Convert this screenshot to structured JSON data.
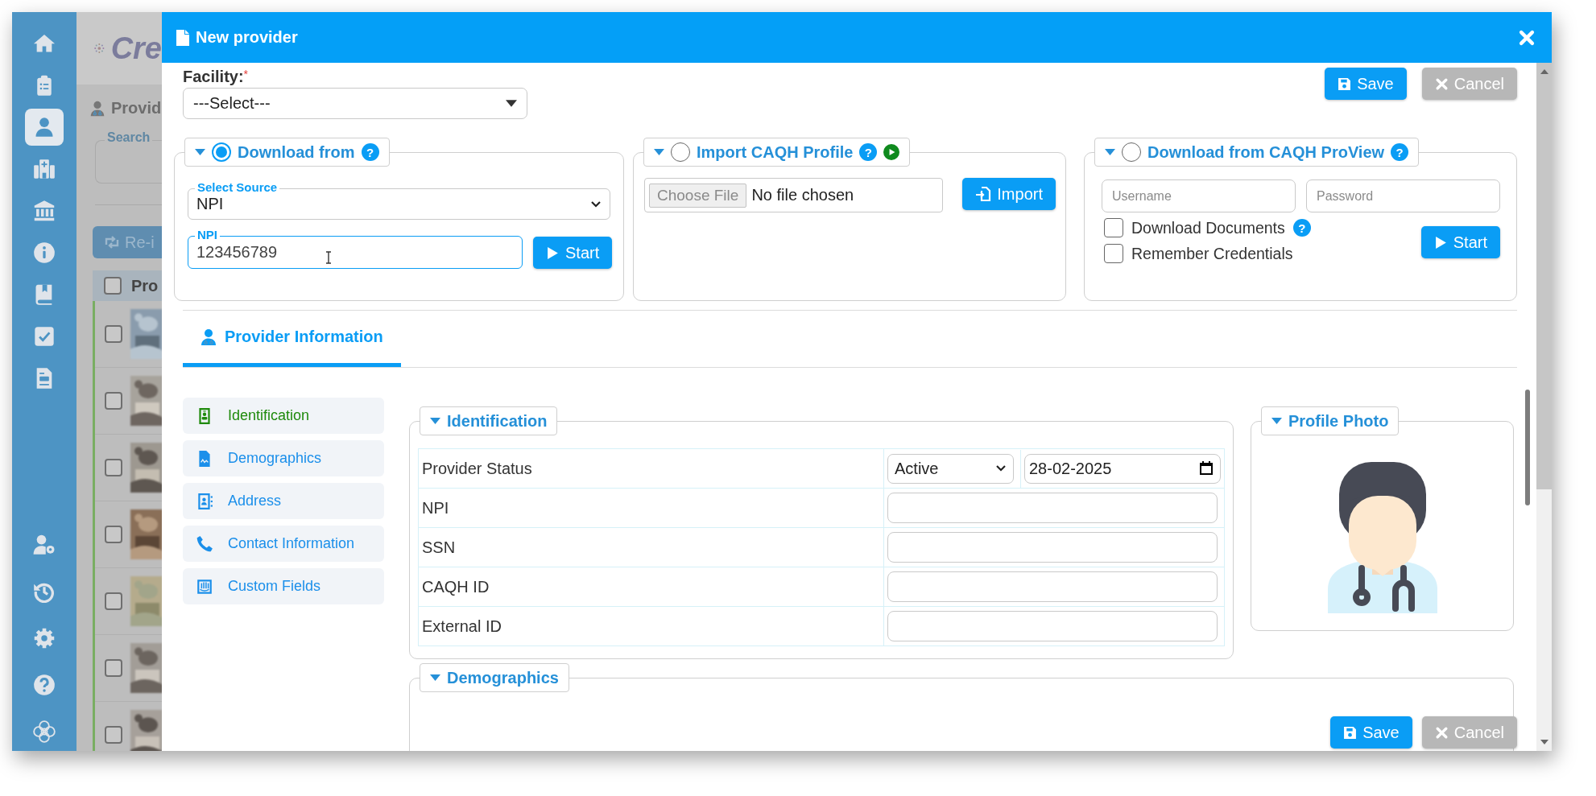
{
  "sidebar": {
    "top_items": [
      {
        "selected": false
      },
      {
        "selected": false
      },
      {
        "selected": true
      },
      {
        "selected": false
      },
      {
        "selected": false
      },
      {
        "selected": false
      },
      {
        "selected": false
      },
      {
        "selected": false
      },
      {
        "selected": false
      }
    ],
    "bottom_items": [
      {
        "selected": false
      },
      {
        "selected": false
      },
      {
        "selected": false
      },
      {
        "selected": false
      },
      {
        "selected": false
      }
    ]
  },
  "background_page": {
    "logo_text": "Cre",
    "title": "Provid",
    "search_label": "Search",
    "reindex_button": "Re-i",
    "column_header": "Pro",
    "header_checked": false,
    "rows": [
      {
        "checked": false
      },
      {
        "checked": false
      },
      {
        "checked": false
      },
      {
        "checked": false
      },
      {
        "checked": false
      },
      {
        "checked": false
      },
      {
        "checked": false
      }
    ]
  },
  "dialog": {
    "title": "New provider",
    "facility": {
      "label": "Facility:",
      "required_mark": "*",
      "value": "---Select---"
    },
    "top_actions": [
      {
        "label": "Save",
        "kind": "primary"
      },
      {
        "label": "Cancel",
        "kind": "secondary"
      }
    ],
    "download_from": {
      "title": "Download from",
      "selected": true,
      "help": "?",
      "source_label": "Select Source",
      "source_value": "NPI",
      "npi_label": "NPI",
      "npi_value": "123456789",
      "button": "Start"
    },
    "import_caqh": {
      "title": "Import CAQH Profile",
      "selected": false,
      "help": "?",
      "play": true,
      "file_button": "Choose File",
      "file_status": "No file chosen",
      "button": "Import"
    },
    "caqh_proview": {
      "title": "Download from CAQH ProView",
      "selected": false,
      "help": "?",
      "username_placeholder": "Username",
      "password_placeholder": "Password",
      "options": [
        {
          "label": "Download Documents",
          "checked": false,
          "help": "?"
        },
        {
          "label": "Remember Credentials",
          "checked": false
        }
      ],
      "button": "Start"
    },
    "tabs": [
      {
        "label": "Provider Information",
        "selected": true
      }
    ],
    "section_nav": [
      {
        "label": "Identification",
        "selected": true
      },
      {
        "label": "Demographics",
        "selected": false
      },
      {
        "label": "Address",
        "selected": false
      },
      {
        "label": "Contact Information",
        "selected": false
      },
      {
        "label": "Custom Fields",
        "selected": false
      }
    ],
    "identification": {
      "title": "Identification",
      "rows": [
        {
          "label": "Provider Status",
          "kind": "status",
          "status": "Active",
          "date": "28-02-2025"
        },
        {
          "label": "NPI",
          "kind": "text"
        },
        {
          "label": "SSN",
          "kind": "text"
        },
        {
          "label": "CAQH ID",
          "kind": "text"
        },
        {
          "label": "External ID",
          "kind": "text"
        }
      ]
    },
    "profile_photo": {
      "title": "Profile Photo"
    },
    "demographics": {
      "title": "Demographics"
    },
    "bottom_actions": [
      {
        "label": "Save",
        "kind": "primary"
      },
      {
        "label": "Cancel",
        "kind": "secondary"
      }
    ]
  }
}
